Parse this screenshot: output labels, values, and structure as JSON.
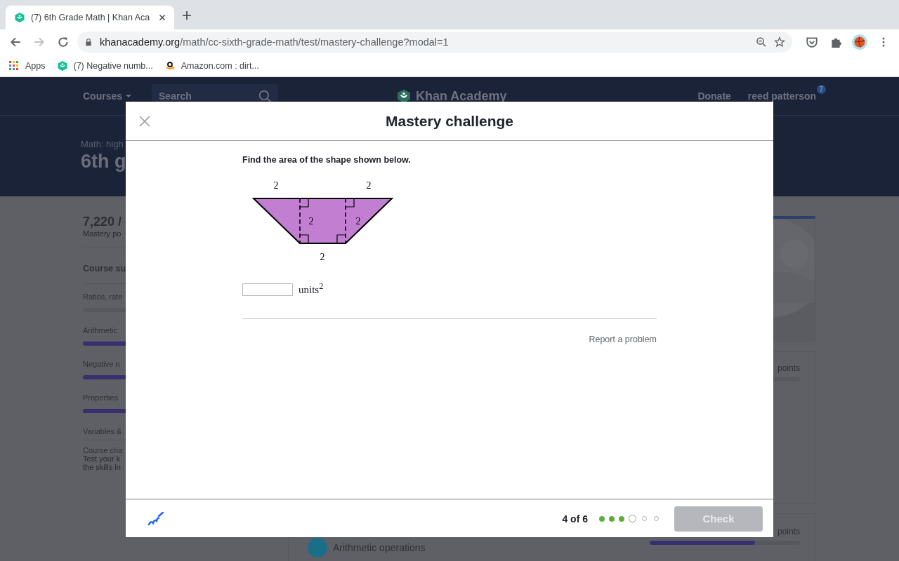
{
  "browser": {
    "tabs": [
      {
        "title": "(7) 6th Grade Math | Khan Aca",
        "selected": true
      }
    ],
    "url_host": "khanacademy.org",
    "url_path": "/math/cc-sixth-grade-math/test/mastery-challenge?modal=1",
    "bookmarks": [
      {
        "kind": "apps",
        "label": "Apps"
      },
      {
        "kind": "site",
        "label": "(7) Negative numb..."
      },
      {
        "kind": "shop",
        "label": "Amazon.com : dirt..."
      }
    ]
  },
  "site_header": {
    "courses": "Courses",
    "search_placeholder": "Search",
    "logo": "Khan Academy",
    "donate": "Donate",
    "user": "reed patterson",
    "notification_count": "7"
  },
  "hero": {
    "subtitle": "Math: high",
    "title": "6th g"
  },
  "sidebar": {
    "points": "7,220 /",
    "points_label": "Mastery po",
    "summary_heading": "Course su",
    "units": [
      {
        "label": "Ratios, rate",
        "kind": "bar",
        "level": 0
      },
      {
        "label": "Arithmetic",
        "kind": "bar",
        "level": 1
      },
      {
        "label": "Negative n",
        "kind": "bar",
        "level": 1
      },
      {
        "label": "Properties",
        "kind": "bar",
        "level": 1
      },
      {
        "label": "Variables &",
        "kind": "no-bar"
      }
    ],
    "challenge_title": "Course cha",
    "challenge_text": [
      "Test your k",
      "the skills in"
    ]
  },
  "cards": [
    {
      "kind": "picture"
    },
    {
      "kind": "points",
      "points_text": "points",
      "level": 0
    },
    {
      "kind": "unit",
      "title": "Arithmetic operations",
      "points_text": "points",
      "level": 0.7
    }
  ],
  "modal": {
    "title": "Mastery challenge",
    "question": "Find the area of the shape shown below.",
    "figure_labels": [
      "2",
      "2",
      "2",
      "2",
      "2"
    ],
    "answer_unit": "units$^{2}$",
    "report_link": "Report a problem",
    "progress_text": "4 of 6",
    "steps": [
      {
        "kind": "done"
      },
      {
        "kind": "done"
      },
      {
        "kind": "done"
      },
      {
        "kind": "current"
      },
      {
        "kind": "pending"
      },
      {
        "kind": "pending"
      }
    ],
    "check_button": {
      "label": "Check",
      "disabled": true
    }
  }
}
